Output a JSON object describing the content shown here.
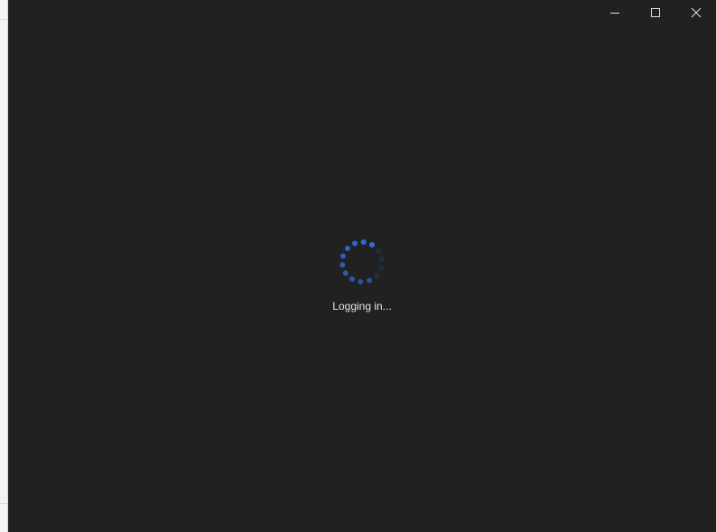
{
  "window": {
    "background": "#212121",
    "caption_buttons": [
      {
        "name": "minimize",
        "icon": "minimize-icon"
      },
      {
        "name": "maximize",
        "icon": "maximize-icon"
      },
      {
        "name": "close",
        "icon": "close-icon"
      }
    ]
  },
  "loading": {
    "status_text": "Logging in...",
    "spinner_color": "#2f6fd6",
    "spinner_dim_color": "#23395e"
  }
}
